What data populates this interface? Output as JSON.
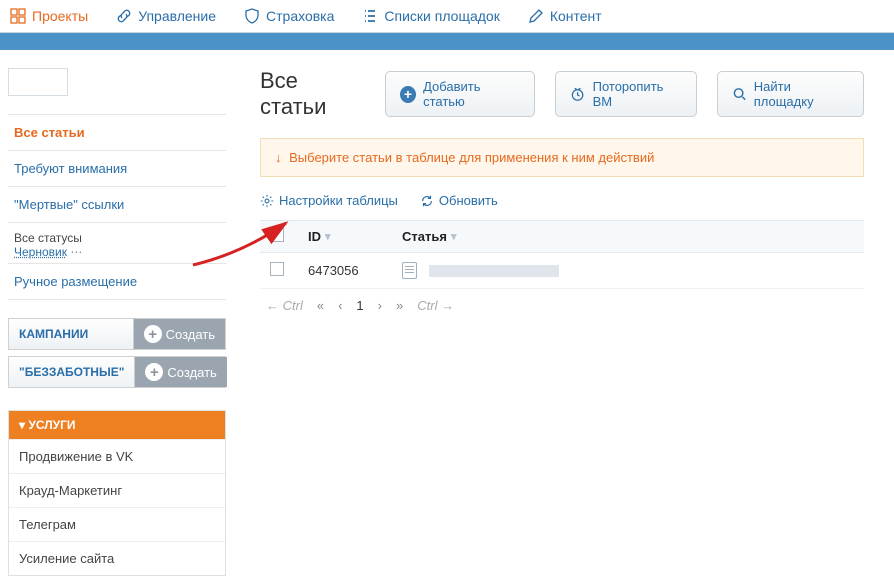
{
  "topnav": [
    {
      "label": "Проекты",
      "icon": "grid",
      "active": true
    },
    {
      "label": "Управление",
      "icon": "link",
      "active": false
    },
    {
      "label": "Страховка",
      "icon": "shield",
      "active": false
    },
    {
      "label": "Списки площадок",
      "icon": "list",
      "active": false
    },
    {
      "label": "Контент",
      "icon": "pen",
      "active": false
    }
  ],
  "sidebar": {
    "filters": [
      {
        "label": "Все статьи",
        "active": true
      },
      {
        "label": "Требуют внимания",
        "active": false
      },
      {
        "label": "\"Мертвые\" ссылки",
        "active": false
      }
    ],
    "status_header": "Все статусы",
    "status_link": "Черновик",
    "manual": "Ручное размещение",
    "panels": [
      {
        "title": "КАМПАНИИ",
        "action": "Создать"
      },
      {
        "title": "\"БЕЗЗАБОТНЫЕ\"",
        "action": "Создать"
      }
    ],
    "services_head": "▾ УСЛУГИ",
    "services": [
      "Продвижение в VK",
      "Крауд-Маркетинг",
      "Телеграм",
      "Усиление сайта"
    ]
  },
  "main": {
    "title": "Все статьи",
    "actions": [
      {
        "label": "Добавить статью",
        "icon": "plus"
      },
      {
        "label": "Поторопить ВМ",
        "icon": "clock"
      },
      {
        "label": "Найти площадку",
        "icon": "search"
      }
    ],
    "notice": "Выберите статьи в таблице для применения к ним действий",
    "tools": {
      "settings": "Настройки таблицы",
      "refresh": "Обновить"
    },
    "columns": {
      "id": "ID",
      "article": "Статья"
    },
    "rows": [
      {
        "id": "6473056"
      }
    ],
    "pager": {
      "prev_hint": "← Ctrl",
      "page": "1",
      "next_hint": "Ctrl →"
    }
  }
}
